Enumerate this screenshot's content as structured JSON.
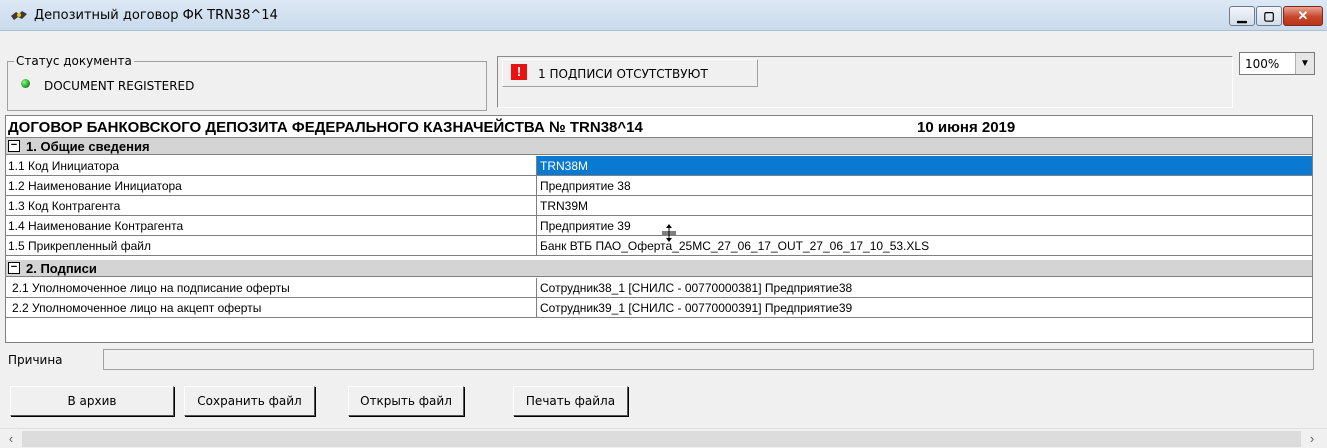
{
  "window": {
    "title": "Депозитный договор ФК TRN38^14",
    "minimize_glyph": "▁",
    "maximize_glyph": "▢",
    "close_glyph": "✕"
  },
  "status": {
    "legend": "Статус документа",
    "value": "DOCUMENT REGISTERED",
    "indicator_color": "#1c8a1c"
  },
  "signatures_warning": {
    "icon": "!",
    "text": "1 ПОДПИСИ ОТСУТСТВУЮТ"
  },
  "zoom": {
    "value": "100%",
    "arrow": "▼"
  },
  "document": {
    "title": "ДОГОВОР БАНКОВСКОГО ДЕПОЗИТА ФЕДЕРАЛЬНОГО КАЗНАЧЕЙСТВА № TRN38^14",
    "date": "10 июня 2019",
    "sections": [
      {
        "toggle": "−",
        "label": "1. Общие сведения",
        "rows": [
          {
            "key": "1.1 Код Инициатора",
            "value": "TRN38M"
          },
          {
            "key": "1.2 Наименование Инициатора",
            "value": "Предприятие 38"
          },
          {
            "key": "1.3 Код Контрагента",
            "value": "TRN39M"
          },
          {
            "key": "1.4 Наименование Контрагента",
            "value": "Предприятие 39"
          },
          {
            "key": "1.5 Прикрепленный файл",
            "value": "Банк ВТБ ПАО_Оферта_25МС_27_06_17_OUT_27_06_17_10_53.XLS"
          }
        ]
      },
      {
        "toggle": "−",
        "label": "2. Подписи",
        "rows": [
          {
            "key": "2.1 Уполномоченное лицо на подписание оферты",
            "value": "Сотрудник38_1 [СНИЛС - 00770000381] Предприятие38"
          },
          {
            "key": "2.2 Уполномоченное лицо на акцепт оферты",
            "value": "Сотрудник39_1 [СНИЛС - 00770000391] Предприятие39"
          }
        ]
      }
    ]
  },
  "reason": {
    "label": "Причина",
    "value": ""
  },
  "buttons": {
    "archive": "В архив",
    "save_file": "Сохранить файл",
    "open_file": "Открыть файл",
    "print_file": "Печать файла"
  },
  "scrollbar": {
    "left": "‹",
    "right": "›"
  },
  "colors": {
    "selection": "#0a79d2",
    "section_bg": "#d4d4d4",
    "warning": "#e81212"
  }
}
